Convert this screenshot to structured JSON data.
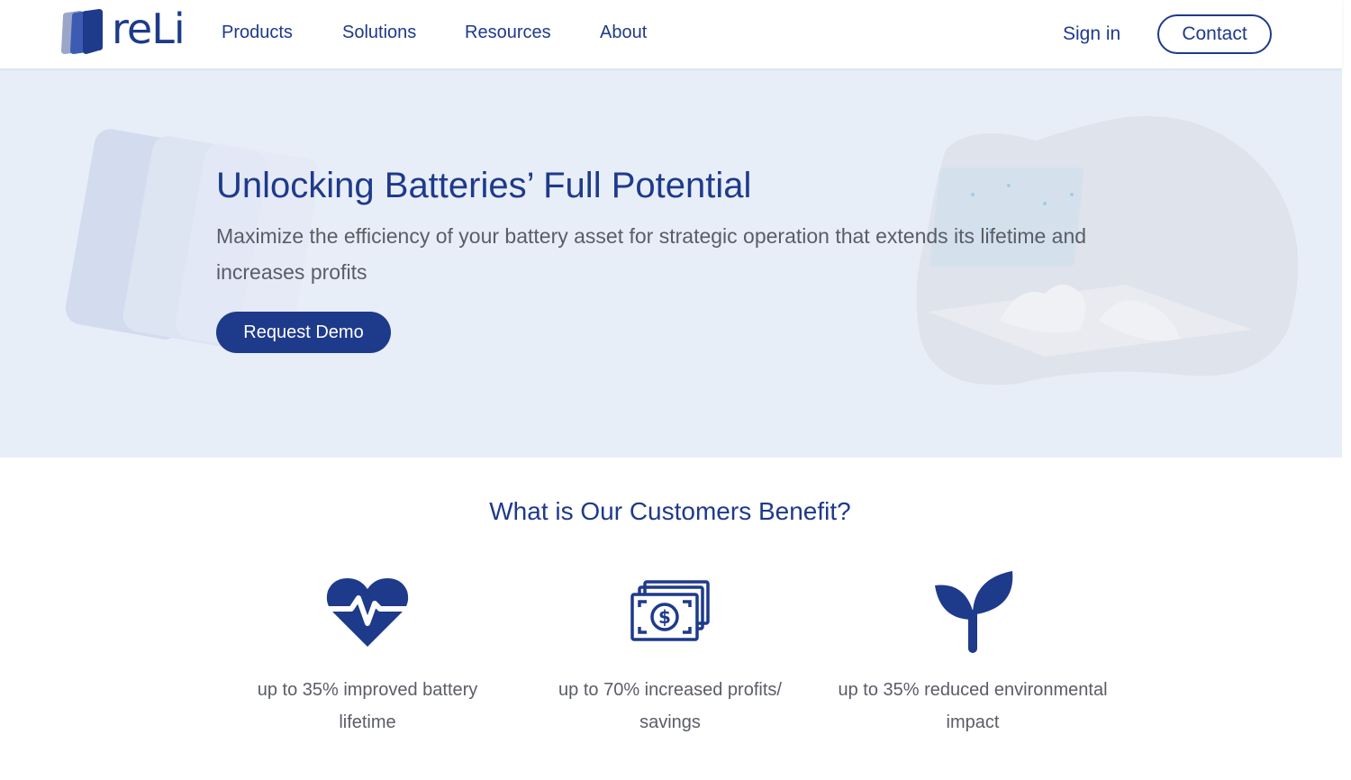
{
  "header": {
    "logo_text": "reLi",
    "nav": [
      {
        "label": "Products"
      },
      {
        "label": "Solutions"
      },
      {
        "label": "Resources"
      },
      {
        "label": "About"
      }
    ],
    "signin_label": "Sign in",
    "contact_label": "Contact"
  },
  "hero": {
    "title": "Unlocking Batteries’ Full Potential",
    "subtitle": "Maximize the efficiency of your battery asset for strategic operation that extends its lifetime and increases profits",
    "cta_label": "Request Demo"
  },
  "benefits": {
    "title": "What is Our Customers Benefit?",
    "items": [
      {
        "icon": "heart-pulse-icon",
        "text": "up to 35% improved battery lifetime"
      },
      {
        "icon": "money-bills-icon",
        "text": "up to 70% increased profits/ savings"
      },
      {
        "icon": "seedling-icon",
        "text": "up to 35% reduced environmental impact"
      }
    ]
  },
  "colors": {
    "brand": "#1e3a8a",
    "hero_bg": "#e8eef8",
    "body_text": "#5a5d66"
  }
}
